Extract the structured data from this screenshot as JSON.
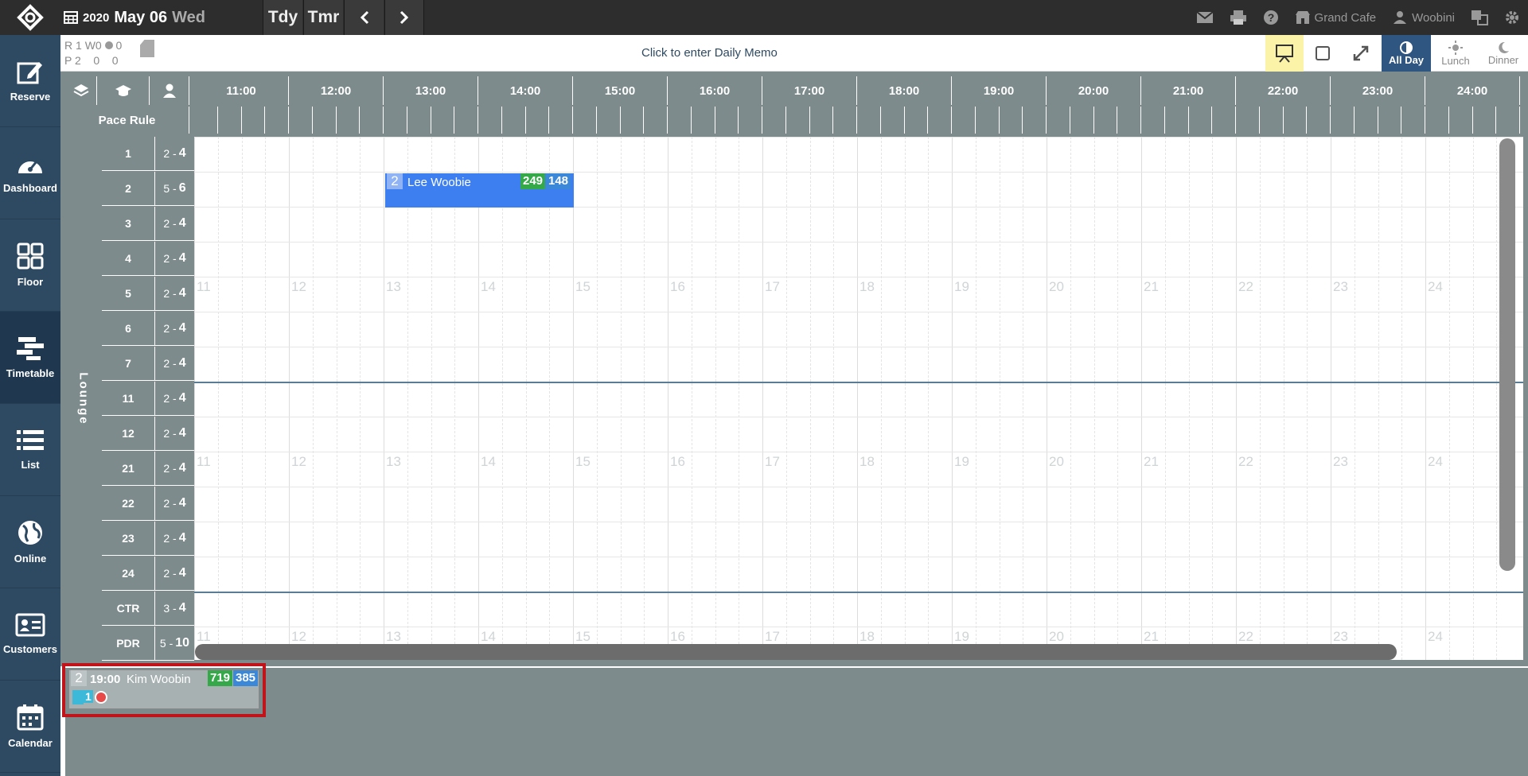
{
  "topbar": {
    "year": "2020",
    "date": "May 06",
    "weekday": "Wed",
    "today_label": "Tdy",
    "tomorrow_label": "Tmr",
    "restaurant": "Grand Cafe",
    "user": "Woobini"
  },
  "sidebar": {
    "items": [
      {
        "label": "Reserve",
        "icon": "edit-icon"
      },
      {
        "label": "Dashboard",
        "icon": "gauge-icon"
      },
      {
        "label": "Floor",
        "icon": "grid-icon"
      },
      {
        "label": "Timetable",
        "icon": "timetable-icon"
      },
      {
        "label": "List",
        "icon": "list-icon"
      },
      {
        "label": "Online",
        "icon": "globe-icon"
      },
      {
        "label": "Customers",
        "icon": "id-card-icon"
      },
      {
        "label": "Calendar",
        "icon": "calendar-icon"
      }
    ],
    "active": "Timetable"
  },
  "stats": {
    "r_label": "R",
    "r1": "1",
    "w_label": "W",
    "w1": "0",
    "w2": "0",
    "p_label": "P",
    "p1": "2",
    "p2": "0",
    "p3": "0"
  },
  "memo": {
    "text": "Click to enter Daily Memo"
  },
  "meals": {
    "all_day": "All Day",
    "lunch": "Lunch",
    "dinner": "Dinner"
  },
  "grid": {
    "pace_rule_label": "Pace Rule",
    "section": "Lounge",
    "hours": [
      "11:00",
      "12:00",
      "13:00",
      "14:00",
      "15:00",
      "16:00",
      "17:00",
      "18:00",
      "19:00",
      "20:00",
      "21:00",
      "22:00",
      "23:00",
      "24:00"
    ],
    "ghost_hours": [
      "11",
      "12",
      "13",
      "14",
      "15",
      "16",
      "17",
      "18",
      "19",
      "20",
      "21",
      "22",
      "23",
      "24"
    ],
    "tables": [
      {
        "name": "1",
        "min": "2",
        "max": "4"
      },
      {
        "name": "2",
        "min": "5",
        "max": "6"
      },
      {
        "name": "3",
        "min": "2",
        "max": "4"
      },
      {
        "name": "4",
        "min": "2",
        "max": "4"
      },
      {
        "name": "5",
        "min": "2",
        "max": "4"
      },
      {
        "name": "6",
        "min": "2",
        "max": "4"
      },
      {
        "name": "7",
        "min": "2",
        "max": "4"
      },
      {
        "name": "11",
        "min": "2",
        "max": "4"
      },
      {
        "name": "12",
        "min": "2",
        "max": "4"
      },
      {
        "name": "21",
        "min": "2",
        "max": "4"
      },
      {
        "name": "22",
        "min": "2",
        "max": "4"
      },
      {
        "name": "23",
        "min": "2",
        "max": "4"
      },
      {
        "name": "24",
        "min": "2",
        "max": "4"
      },
      {
        "name": "CTR",
        "min": "3",
        "max": "4"
      },
      {
        "name": "PDR",
        "min": "5",
        "max": "10"
      }
    ]
  },
  "reservation": {
    "party": "2",
    "name": "Lee Woobie",
    "code_green": "249",
    "code_blue": "148",
    "color": "#3d7ff0"
  },
  "waitlist": {
    "party": "2",
    "time": "19:00",
    "name": "Kim Woobin",
    "code_green": "719",
    "code_blue": "385",
    "child_count": "1"
  }
}
